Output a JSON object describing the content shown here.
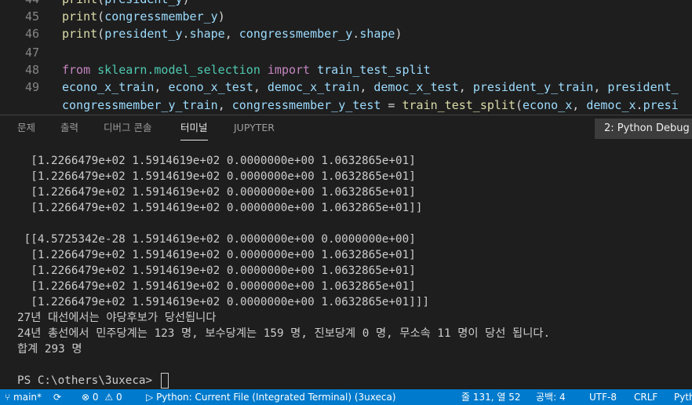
{
  "editor": {
    "lines": [
      {
        "num": "44",
        "parts": [
          [
            "fn",
            "print"
          ],
          [
            "punc",
            "("
          ],
          [
            "var",
            "president_y"
          ],
          [
            "punc",
            ")"
          ]
        ]
      },
      {
        "num": "45",
        "parts": [
          [
            "fn",
            "print"
          ],
          [
            "punc",
            "("
          ],
          [
            "var",
            "congressmember_y"
          ],
          [
            "punc",
            ")"
          ]
        ]
      },
      {
        "num": "46",
        "parts": [
          [
            "fn",
            "print"
          ],
          [
            "punc",
            "("
          ],
          [
            "var",
            "president_y"
          ],
          [
            "punc",
            "."
          ],
          [
            "var",
            "shape"
          ],
          [
            "punc",
            ", "
          ],
          [
            "var",
            "congressmember_y"
          ],
          [
            "punc",
            "."
          ],
          [
            "var",
            "shape"
          ],
          [
            "punc",
            ")"
          ]
        ]
      },
      {
        "num": "47",
        "parts": []
      },
      {
        "num": "48",
        "parts": [
          [
            "kw",
            "from"
          ],
          [
            "punc",
            " "
          ],
          [
            "mod",
            "sklearn.model_selection"
          ],
          [
            "punc",
            " "
          ],
          [
            "kw",
            "import"
          ],
          [
            "punc",
            " "
          ],
          [
            "var",
            "train_test_split"
          ]
        ]
      },
      {
        "num": "49",
        "parts": [
          [
            "var",
            "econo_x_train"
          ],
          [
            "punc",
            ", "
          ],
          [
            "var",
            "econo_x_test"
          ],
          [
            "punc",
            ", "
          ],
          [
            "var",
            "democ_x_train"
          ],
          [
            "punc",
            ", "
          ],
          [
            "var",
            "democ_x_test"
          ],
          [
            "punc",
            ", "
          ],
          [
            "var",
            "president_y_train"
          ],
          [
            "punc",
            ", "
          ],
          [
            "var",
            "president_"
          ]
        ]
      },
      {
        "num": "",
        "parts": [
          [
            "var",
            "congressmember_y_train"
          ],
          [
            "punc",
            ", "
          ],
          [
            "var",
            "congressmember_y_test"
          ],
          [
            "punc",
            " = "
          ],
          [
            "fn",
            "train_test_split"
          ],
          [
            "punc",
            "("
          ],
          [
            "var",
            "econo_x"
          ],
          [
            "punc",
            ", "
          ],
          [
            "var",
            "democ_x"
          ],
          [
            "punc",
            "."
          ],
          [
            "var",
            "presi"
          ]
        ]
      }
    ]
  },
  "panel": {
    "tabs": [
      {
        "label": "문제",
        "active": false
      },
      {
        "label": "출력",
        "active": false
      },
      {
        "label": "디버그 콘솔",
        "active": false
      },
      {
        "label": "터미널",
        "active": true
      },
      {
        "label": "JUPYTER",
        "active": false
      }
    ],
    "terminal_select": "2: Python Debug"
  },
  "terminal": {
    "lines": [
      "  [1.2266479e+02 1.5914619e+02 0.0000000e+00 1.0632865e+01]",
      "  [1.2266479e+02 1.5914619e+02 0.0000000e+00 1.0632865e+01]",
      "  [1.2266479e+02 1.5914619e+02 0.0000000e+00 1.0632865e+01]",
      "  [1.2266479e+02 1.5914619e+02 0.0000000e+00 1.0632865e+01]]",
      "",
      " [[4.5725342e-28 1.5914619e+02 0.0000000e+00 0.0000000e+00]",
      "  [1.2266479e+02 1.5914619e+02 0.0000000e+00 1.0632865e+01]",
      "  [1.2266479e+02 1.5914619e+02 0.0000000e+00 1.0632865e+01]",
      "  [1.2266479e+02 1.5914619e+02 0.0000000e+00 1.0632865e+01]",
      "  [1.2266479e+02 1.5914619e+02 0.0000000e+00 1.0632865e+01]]]",
      "27년 대선에서는 야당후보가 당선됩니다",
      "24년 총선에서 민주당계는 123 명, 보수당계는 159 명, 진보당계 0 명, 무소속 11 명이 당선 됩니다.",
      "합계 293 명",
      "",
      "PS C:\\others\\3uxeca> "
    ]
  },
  "status": {
    "branch": "main*",
    "errors": "0",
    "warnings": "0",
    "run_config": "Python: Current File (Integrated Terminal) (3uxeca)",
    "cursor_pos": "줄 131, 열 52",
    "spaces": "공백: 4",
    "encoding": "UTF-8",
    "eol": "CRLF",
    "language": "Python"
  }
}
